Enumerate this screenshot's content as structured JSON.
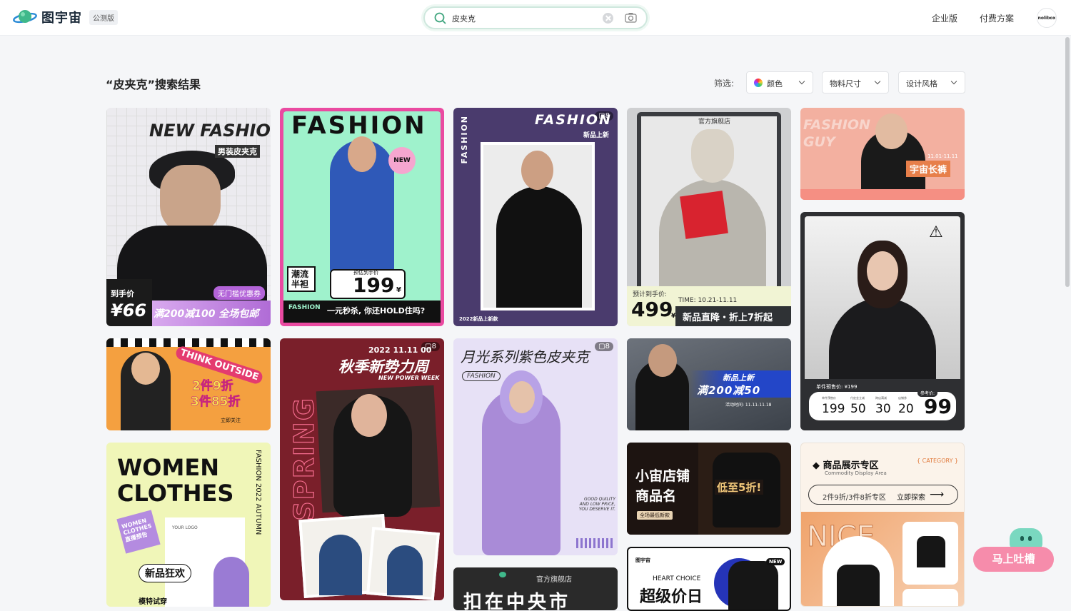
{
  "header": {
    "brand": "图宇宙",
    "beta_badge": "公测版",
    "search_value": "皮夹克",
    "nav": [
      "企业版",
      "付费方案"
    ],
    "avatar_text": "nolibox"
  },
  "results": {
    "title": "“皮夹克”搜索结果",
    "filter_label": "筛选:",
    "filters": [
      "颜色",
      "物料尺寸",
      "设计风格"
    ]
  },
  "cards": {
    "c1": {
      "headline": "NEW FASHIO",
      "tag": "男装皮夹克",
      "price_label": "到手价",
      "price": "¥66",
      "coupon": "无门槛优惠券",
      "promo": "满200减100 全场包邮"
    },
    "c2": {
      "headline": "FASHION",
      "new_badge": "NEW",
      "side": "潮流半袒",
      "price_label": "预估到手价",
      "price": "199",
      "currency": "¥",
      "footer_brand": "FASHION",
      "footer_text": "一元秒杀, 你还HOLD住吗?"
    },
    "c3": {
      "headline": "FASHION",
      "sub": "新品上新",
      "side": "FASHION",
      "footer": "2022新品上新款",
      "count": "8"
    },
    "c4": {
      "shop": "官方旗舰店",
      "price_label": "预计到手价:",
      "price": "499",
      "currency": "¥",
      "time": "TIME: 10.21-11.11",
      "promo": "新品直降・折上7折起"
    },
    "c5": {
      "title": "FASHION GUY",
      "date": "11.01-11.11",
      "tag": "宇宙长裤"
    },
    "c6": {
      "headline": "THINK OUTSIDE",
      "line1": "2件9折",
      "line2": "3件85折",
      "footer": "立即关注"
    },
    "c7": {
      "date": "2022 11.11 00",
      "title": "秋季新势力周",
      "sub": "NEW POWER WEEK",
      "side": "SPRING",
      "count": "8"
    },
    "c8": {
      "title": "月光系列紫色皮夹克",
      "tag": "FASHION",
      "blurb": "GOOD QUILITY AND LOW PRICE, YOU DESERVE IT.",
      "count": "8"
    },
    "c9": {
      "line1": "新品上新",
      "line2": "满200减50",
      "sub": "活动时间: 11.11-11.18"
    },
    "c10": {
      "presale": "单件预售价: ¥199",
      "labels": [
        "单件预售价",
        "付定金立减",
        "跨店满减",
        "店铺券",
        "参考价:"
      ],
      "values": [
        "199",
        "50",
        "30",
        "20",
        "99"
      ]
    },
    "c11": {
      "line1": "WOMEN",
      "line2": "CLOTHES",
      "side": "FASHION 2022 AUTUMN",
      "sticker": "WOMEN CLOTHES 直播预告",
      "logo": "YOUR LOGO",
      "pill": "新品狂欢",
      "bottom": "模特试穿"
    },
    "c12": {
      "line1": "小宙店铺",
      "line2": "商品名",
      "sub": "全场最低新款",
      "promo": "低至5折!"
    },
    "c13": {
      "title": "商品展示专区",
      "sub": "Commodity Display Area",
      "category": "CATEGORY",
      "pill": "2件9折/3件8折专区",
      "cta": "立即探索",
      "big": "NICE"
    },
    "c14": {
      "shop": "官方旗舰店",
      "title": "扣在中央市"
    },
    "c15": {
      "brand": "图宇宙",
      "line1": "HEART CHOICE",
      "line2": "超级价日",
      "badge": "NEW"
    }
  },
  "feedback": {
    "label": "马上吐槽"
  }
}
